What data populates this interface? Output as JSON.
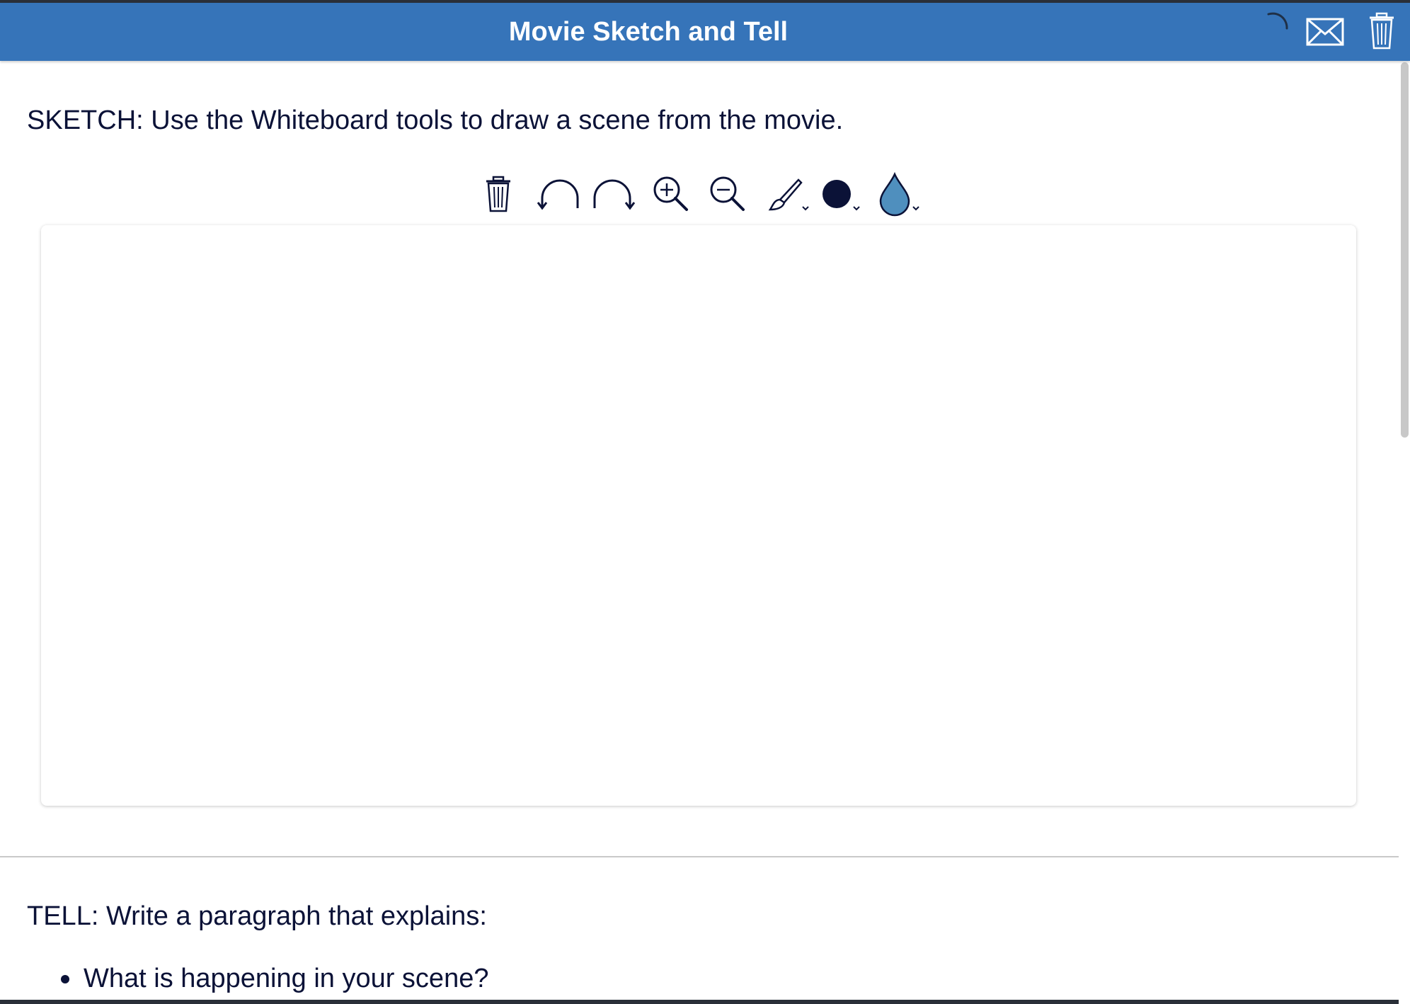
{
  "header": {
    "title": "Movie Sketch and Tell",
    "icons": [
      "loading-spinner-icon",
      "mail-icon",
      "trash-icon"
    ]
  },
  "sketch": {
    "instructions": "SKETCH: Use the Whiteboard tools to draw a scene from the movie."
  },
  "whiteboard": {
    "tools": [
      "trash-icon",
      "undo-icon",
      "redo-icon",
      "zoom-in-icon",
      "zoom-out-icon",
      "brush-icon",
      "color-dot-icon",
      "fill-drop-icon"
    ],
    "selected_color": "#0b1237",
    "fill_color": "#4f8fbe"
  },
  "tell": {
    "heading": "TELL: Write a paragraph that explains:",
    "bullets": [
      "What is happening in your scene?"
    ]
  },
  "colors": {
    "header_bg": "#3674b9",
    "text": "#0b1237"
  }
}
